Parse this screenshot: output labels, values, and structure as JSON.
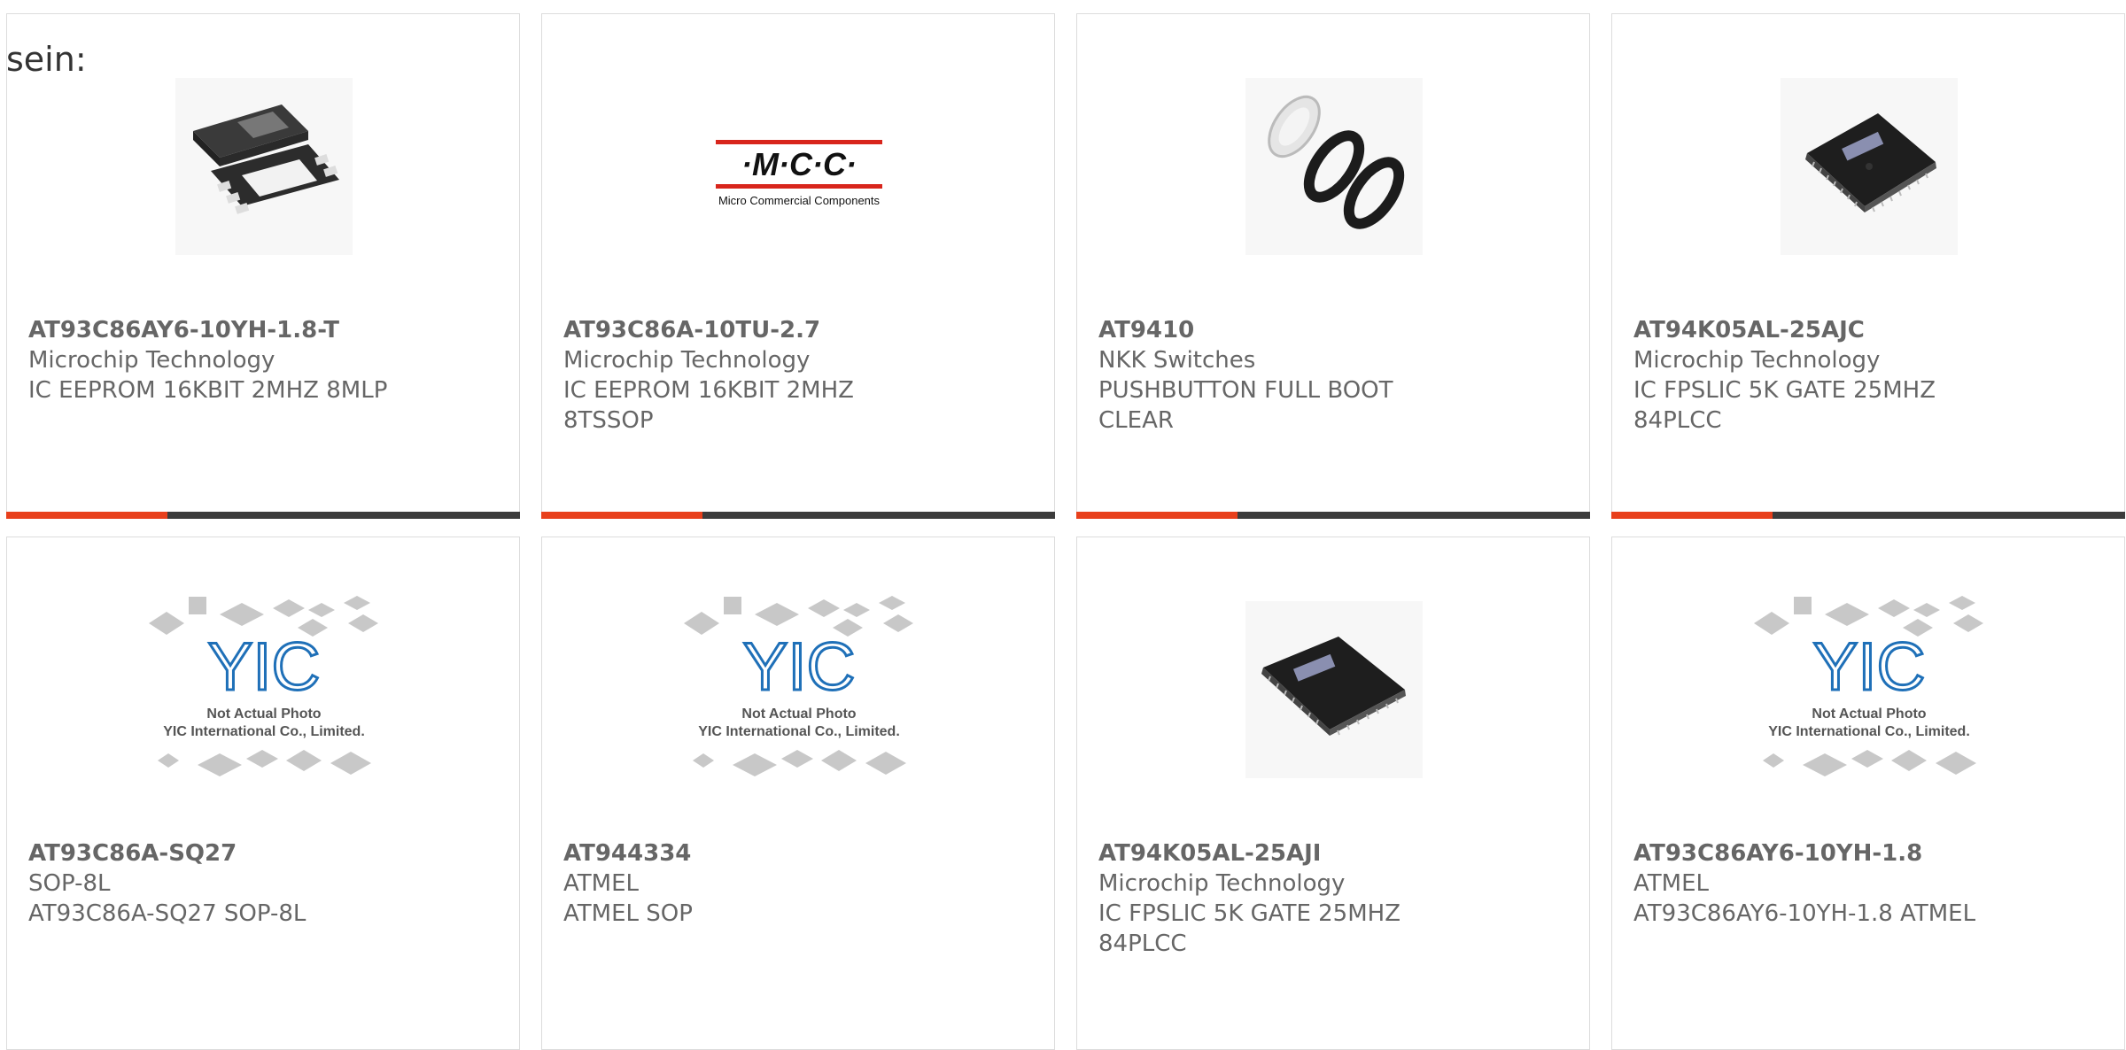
{
  "intro_text": "sein:",
  "products": [
    {
      "part_number": "AT93C86AY6-10YH-1.8-T",
      "manufacturer": "Microchip Technology",
      "description": "IC EEPROM 16KBIT 2MHZ 8MLP",
      "image": "dfn-chip-icon"
    },
    {
      "part_number": "AT93C86A-10TU-2.7",
      "manufacturer": "Microchip Technology",
      "description": "IC EEPROM 16KBIT 2MHZ 8TSSOP",
      "image": "mcc-logo",
      "logo_text": "·M·C·C·",
      "logo_sub": "Micro Commercial Components"
    },
    {
      "part_number": "AT9410",
      "manufacturer": "NKK Switches",
      "description": "PUSHBUTTON FULL BOOT CLEAR",
      "image": "boot-rings-icon"
    },
    {
      "part_number": "AT94K05AL-25AJC",
      "manufacturer": "Microchip Technology",
      "description": "IC FPSLIC 5K GATE 25MHZ 84PLCC",
      "image": "plcc-chip-icon"
    },
    {
      "part_number": "AT93C86A-SQ27",
      "manufacturer": "SOP-8L",
      "description": "AT93C86A-SQ27 SOP-8L",
      "image": "placeholder-photo",
      "ph_line1": "Not Actual Photo",
      "ph_line2": "YIC International Co., Limited."
    },
    {
      "part_number": "AT944334",
      "manufacturer": "ATMEL",
      "description": "ATMEL SOP",
      "image": "placeholder-photo",
      "ph_line1": "Not Actual Photo",
      "ph_line2": "YIC International Co., Limited."
    },
    {
      "part_number": "AT94K05AL-25AJI",
      "manufacturer": "Microchip Technology",
      "description": "IC FPSLIC 5K GATE 25MHZ 84PLCC",
      "image": "plcc-chip-icon"
    },
    {
      "part_number": "AT93C86AY6-10YH-1.8",
      "manufacturer": "ATMEL",
      "description": "AT93C86AY6-10YH-1.8 ATMEL",
      "image": "placeholder-photo",
      "ph_line1": "Not Actual Photo",
      "ph_line2": "YIC International Co., Limited."
    }
  ],
  "colors": {
    "accent": "#e8401c",
    "bar": "#3c3c3c",
    "text": "#666666",
    "border": "#dcdcdc"
  }
}
